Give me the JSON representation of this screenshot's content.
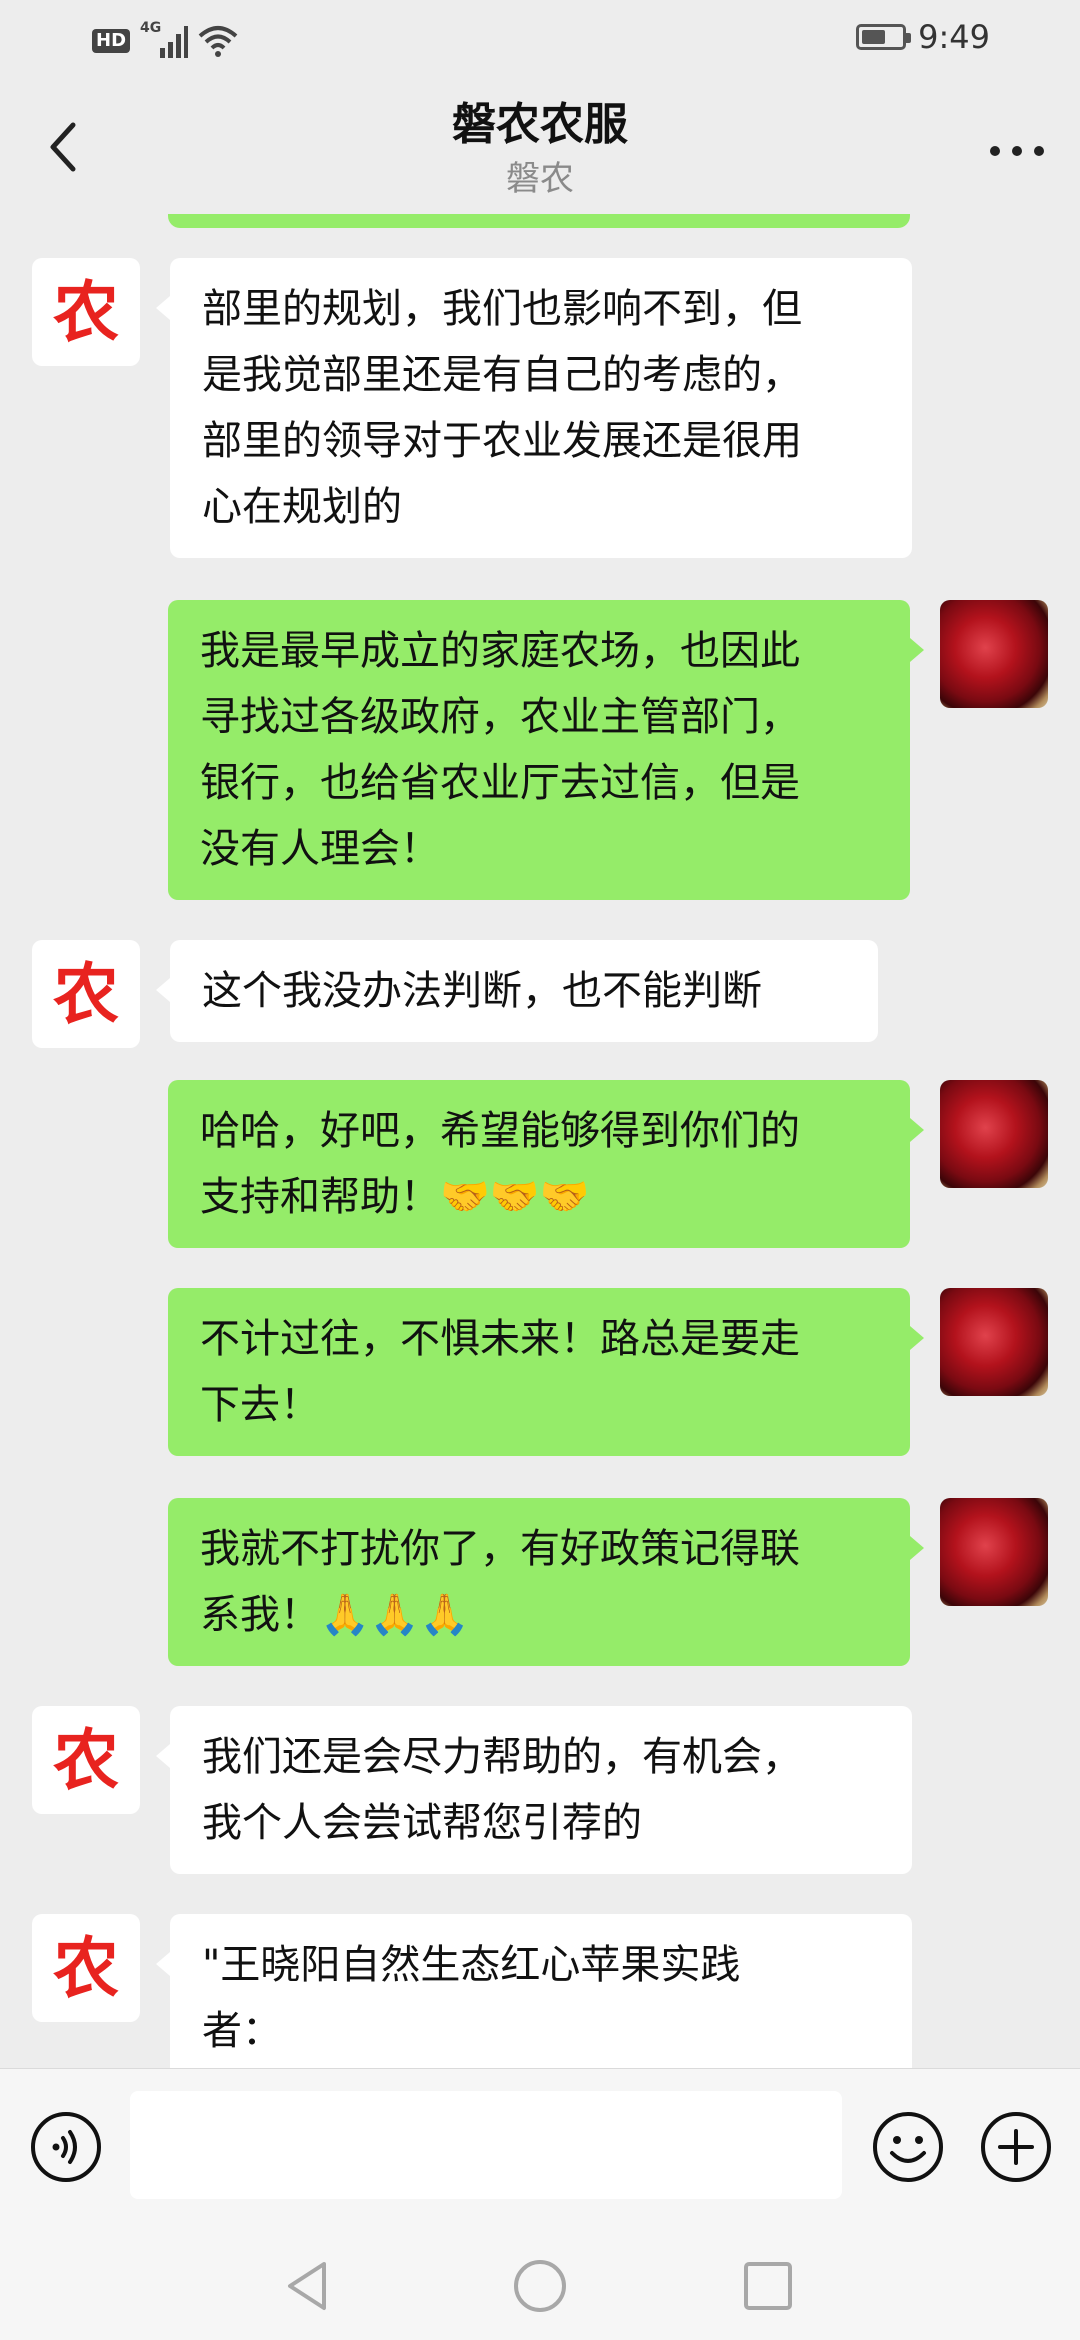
{
  "status_bar": {
    "hd": "HD",
    "network": "4G",
    "time": "9:49",
    "battery_level": 0.6
  },
  "header": {
    "title": "磐农农服",
    "subtitle": "磐农",
    "back_icon": "chevron-left-icon",
    "more_icon": "more-dots-icon"
  },
  "avatars": {
    "left_char": "农"
  },
  "messages": [
    {
      "side": "left",
      "lines": [
        "部里的规划，我们也影响不到，但",
        "是我觉部里还是有自己的考虑的，",
        "部里的领导对于农业发展还是很用",
        "心在规划的"
      ]
    },
    {
      "side": "right",
      "lines": [
        "我是最早成立的家庭农场，也因此",
        "寻找过各级政府，农业主管部门，",
        "银行，也给省农业厅去过信，但是",
        "没有人理会！"
      ]
    },
    {
      "side": "left",
      "lines": [
        "这个我没办法判断，也不能判断"
      ]
    },
    {
      "side": "right",
      "lines": [
        "哈哈，好吧，希望能够得到你们的",
        "支持和帮助！🤝🤝🤝"
      ]
    },
    {
      "side": "right",
      "lines": [
        "不计过往，不惧未来！路总是要走",
        "下去！"
      ]
    },
    {
      "side": "right",
      "lines": [
        "我就不打扰你了，有好政策记得联",
        "系我！🙏🙏🙏"
      ]
    },
    {
      "side": "left",
      "lines": [
        "我们还是会尽力帮助的，有机会，",
        "我个人会尝试帮您引荐的"
      ]
    },
    {
      "side": "left",
      "lines": [
        "\"王晓阳自然生态红心苹果实践",
        "者："
      ]
    }
  ],
  "input_bar": {
    "voice_icon": "voice-icon",
    "emoji_icon": "emoji-icon",
    "plus_icon": "plus-icon",
    "value": ""
  },
  "nav_bar": {
    "back_icon": "triangle-back-icon",
    "home_icon": "circle-home-icon",
    "recents_icon": "square-recents-icon"
  },
  "colors": {
    "background": "#ededed",
    "bubble_self": "#95ec69",
    "bubble_other": "#ffffff",
    "logo_red": "#e8231f"
  }
}
